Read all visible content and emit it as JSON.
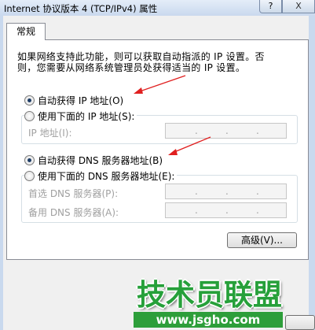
{
  "window": {
    "title": "Internet 协议版本 4 (TCP/IPv4) 属性",
    "help_label": "?",
    "close_label": "X"
  },
  "tabs": [
    {
      "label": "常规",
      "selected": true
    }
  ],
  "general": {
    "description_line1": "如果网络支持此功能，则可以获取自动指派的 IP 设置。否",
    "description_line2": "则，您需要从网络系统管理员处获得适当的 IP 设置。",
    "ip_auto_label": "自动获得 IP 地址(O)",
    "ip_auto_selected": true,
    "ip_manual_label": "使用下面的 IP 地址(S):",
    "ip_manual_selected": false,
    "ip_address_label": "IP 地址(I):",
    "dns_auto_label": "自动获得 DNS 服务器地址(B)",
    "dns_auto_selected": true,
    "dns_manual_label": "使用下面的 DNS 服务器地址(E):",
    "dns_manual_selected": false,
    "dns_preferred_label": "首选 DNS 服务器(P):",
    "dns_alternate_label": "备用 DNS 服务器(A):",
    "advanced_button_label": "高级(V)..."
  },
  "ip_field_separator": ".",
  "watermark": {
    "title": "技术员联盟",
    "url": "www.jsgho.com"
  },
  "colors": {
    "annotation_arrow": "#e02020",
    "watermark_green": "#2d9e3a",
    "disabled_text": "#a0a0a0"
  }
}
